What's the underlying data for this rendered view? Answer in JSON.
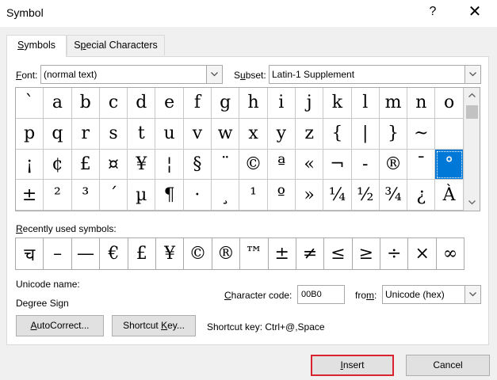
{
  "window": {
    "title": "Symbol",
    "help": "?",
    "close": "✕"
  },
  "tabs": [
    {
      "label": "Symbols",
      "underline": "S",
      "rest": "ymbols"
    },
    {
      "label": "Special Characters",
      "pre": "S",
      "underline": "p",
      "rest": "ecial Characters"
    }
  ],
  "font": {
    "label_u": "F",
    "label_rest": "ont:",
    "value": "(normal text)"
  },
  "subset": {
    "label_pre": "S",
    "label_u": "u",
    "label_rest": "bset:",
    "value": "Latin-1 Supplement"
  },
  "symbol_grid": {
    "selected_index": 47,
    "cells": [
      "`",
      "a",
      "b",
      "c",
      "d",
      "e",
      "f",
      "g",
      "h",
      "i",
      "j",
      "k",
      "l",
      "m",
      "n",
      "o",
      "p",
      "q",
      "r",
      "s",
      "t",
      "u",
      "v",
      "w",
      "x",
      "y",
      "z",
      "{",
      "|",
      "}",
      "~",
      "",
      "¡",
      "¢",
      "£",
      "¤",
      "¥",
      "¦",
      "§",
      "¨",
      "©",
      "ª",
      "«",
      "¬",
      "-",
      "®",
      "¯",
      "°",
      "±",
      "²",
      "³",
      "´",
      "µ",
      "¶",
      "·",
      "¸",
      "¹",
      "º",
      "»",
      "¼",
      "½",
      "¾",
      "¿",
      "À"
    ]
  },
  "recent": {
    "label_u": "R",
    "label_rest": "ecently used symbols:",
    "symbols": [
      "च",
      "–",
      "—",
      "€",
      "£",
      "¥",
      "©",
      "®",
      "™",
      "±",
      "≠",
      "≤",
      "≥",
      "÷",
      "×",
      "∞"
    ]
  },
  "unicode_name": {
    "label": "Unicode name:",
    "value": "Degree Sign"
  },
  "char_code": {
    "label_u": "C",
    "label_rest": "haracter code:",
    "value": "00B0"
  },
  "from": {
    "label_pre": "fro",
    "label_u": "m",
    "label_rest": ":",
    "value": "Unicode (hex)"
  },
  "buttons": {
    "autocorrect": {
      "u": "A",
      "rest": "utoCorrect..."
    },
    "shortcut_key": {
      "pre": "Shortcut ",
      "u": "K",
      "rest": "ey..."
    },
    "insert": {
      "u": "I",
      "rest": "nsert"
    },
    "cancel": "Cancel"
  },
  "shortcut_key_text": "Shortcut key: Ctrl+@,Space"
}
